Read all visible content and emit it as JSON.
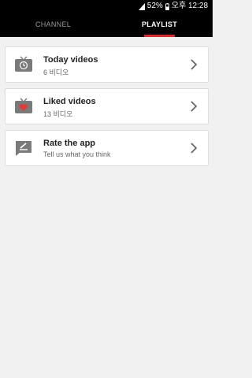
{
  "status_bar": {
    "battery_percent": "52%",
    "time": "오후 12:28"
  },
  "tabs": [
    {
      "label": "CHANNEL",
      "selected": false
    },
    {
      "label": "PLAYLIST",
      "selected": true
    }
  ],
  "colors": {
    "accent": "#d32f2f",
    "header_bg": "#000000",
    "icon_gray": "#7a7a7a"
  },
  "playlist_items": [
    {
      "title": "Today videos",
      "subtitle": "6 비디오",
      "icon": "tv-history-icon"
    },
    {
      "title": "Liked videos",
      "subtitle": "13 비디오",
      "icon": "tv-heart-icon"
    },
    {
      "title": "Rate the app",
      "subtitle": "Tell us what you think",
      "icon": "rate-feedback-icon"
    }
  ]
}
